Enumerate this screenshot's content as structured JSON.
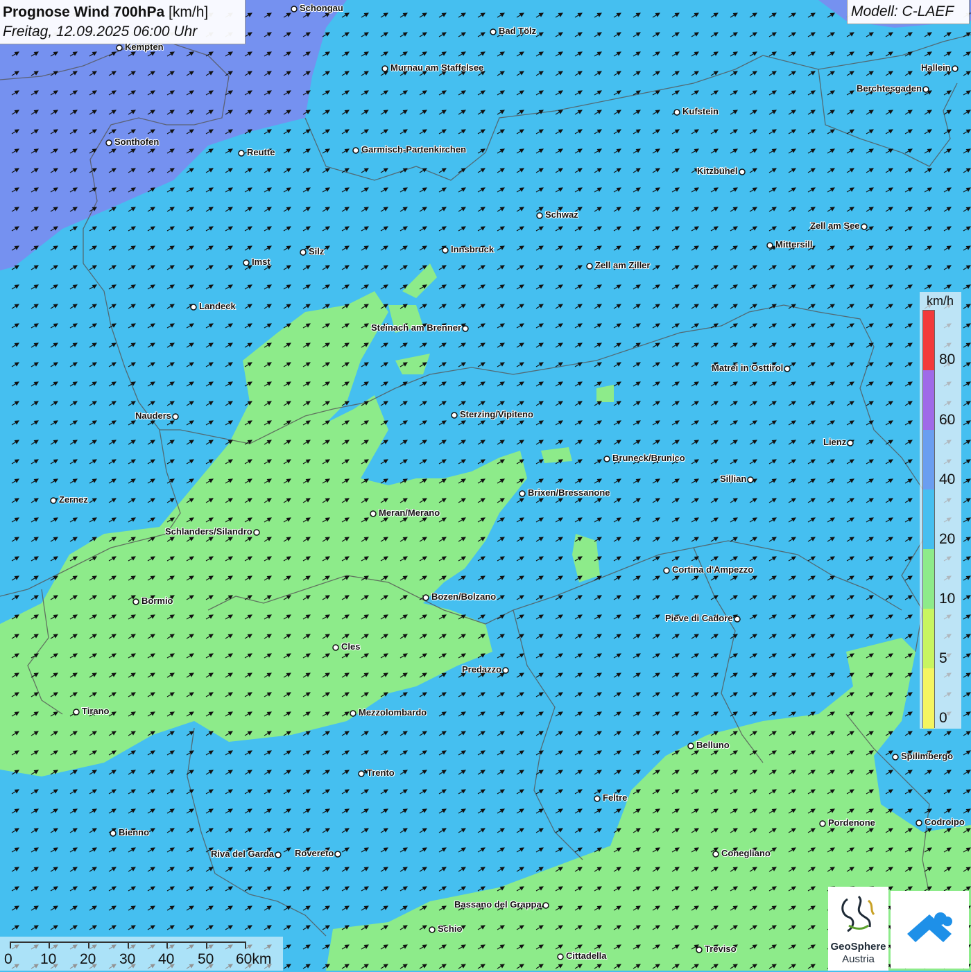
{
  "header": {
    "title_bold": "Prognose Wind 700hPa",
    "title_unit": "[km/h]",
    "datetime": "Freitag, 12.09.2025 06:00 Uhr"
  },
  "model": {
    "label": "Modell: C-LAEF"
  },
  "legend": {
    "unit": "km/h",
    "labels": [
      "80",
      "60",
      "40",
      "20",
      "10",
      "5",
      "0"
    ],
    "colors": [
      "#f23a3a",
      "#9f6ae8",
      "#6a9ef0",
      "#45bff0",
      "#8deb8a",
      "#c8f560",
      "#f5f560"
    ]
  },
  "scale": {
    "labels": [
      "0",
      "10",
      "20",
      "30",
      "40",
      "50",
      "60km"
    ]
  },
  "logos": {
    "geosphere_line1": "GeoSphere",
    "geosphere_line2": "Austria"
  },
  "colors": {
    "field_blue": "#45bff0",
    "field_purple": "#7a8cf0",
    "field_green": "#8deb8a",
    "arrow": "#111111",
    "border": "#555555"
  },
  "cities": [
    "Schongau",
    "Bad Tölz",
    "Kempten",
    "Murnau am Staffelsee",
    "Hallein",
    "Berchtesgaden",
    "Kufstein",
    "Sonthofen",
    "Reutte",
    "Garmisch-Partenkirchen",
    "Kitzbühel",
    "Schwaz",
    "Zell am See",
    "Mittersill",
    "Innsbruck",
    "Silz",
    "Imst",
    "Zell am Ziller",
    "Landeck",
    "Steinach am Brenner",
    "Matrei in Osttirol",
    "Nauders",
    "Sterzing/Vipiteno",
    "Lienz",
    "Bruneck/Brunico",
    "Sillian",
    "Zernez",
    "Brixen/Bressanone",
    "Meran/Merano",
    "Schlanders/Silandro",
    "Cortina d'Ampezzo",
    "Bormio",
    "Bozen/Bolzano",
    "Pieve di Cadore",
    "Cles",
    "Predazzo",
    "Tirano",
    "Mezzolombardo",
    "Belluno",
    "Spilimbergo",
    "Trento",
    "Feltre",
    "Pordenone",
    "Codroipo",
    "Bienno",
    "Riva del Garda",
    "Rovereto",
    "Conegliano",
    "Bassano del Grappa",
    "Schio",
    "Treviso",
    "Cittadella"
  ]
}
